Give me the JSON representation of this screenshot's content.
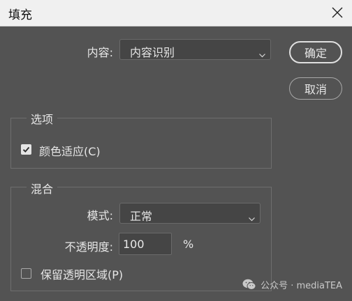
{
  "window": {
    "title": "填充"
  },
  "content_row": {
    "label": "内容:",
    "selected": "内容识别"
  },
  "buttons": {
    "ok": "确定",
    "cancel": "取消"
  },
  "options_group": {
    "title": "选项",
    "color_adapt_label": "颜色适应(C)",
    "color_adapt_checked": true
  },
  "blend_group": {
    "title": "混合",
    "mode_label": "模式:",
    "mode_selected": "正常",
    "opacity_label": "不透明度:",
    "opacity_value": "100",
    "opacity_unit": "%",
    "preserve_label": "保留透明区域(P)",
    "preserve_checked": false
  },
  "watermark": {
    "text": "公众号 · mediaTEA",
    "icon": "wechat-icon"
  },
  "colors": {
    "background": "#535353",
    "titlebar": "#f0f0f0",
    "field": "#454545"
  }
}
